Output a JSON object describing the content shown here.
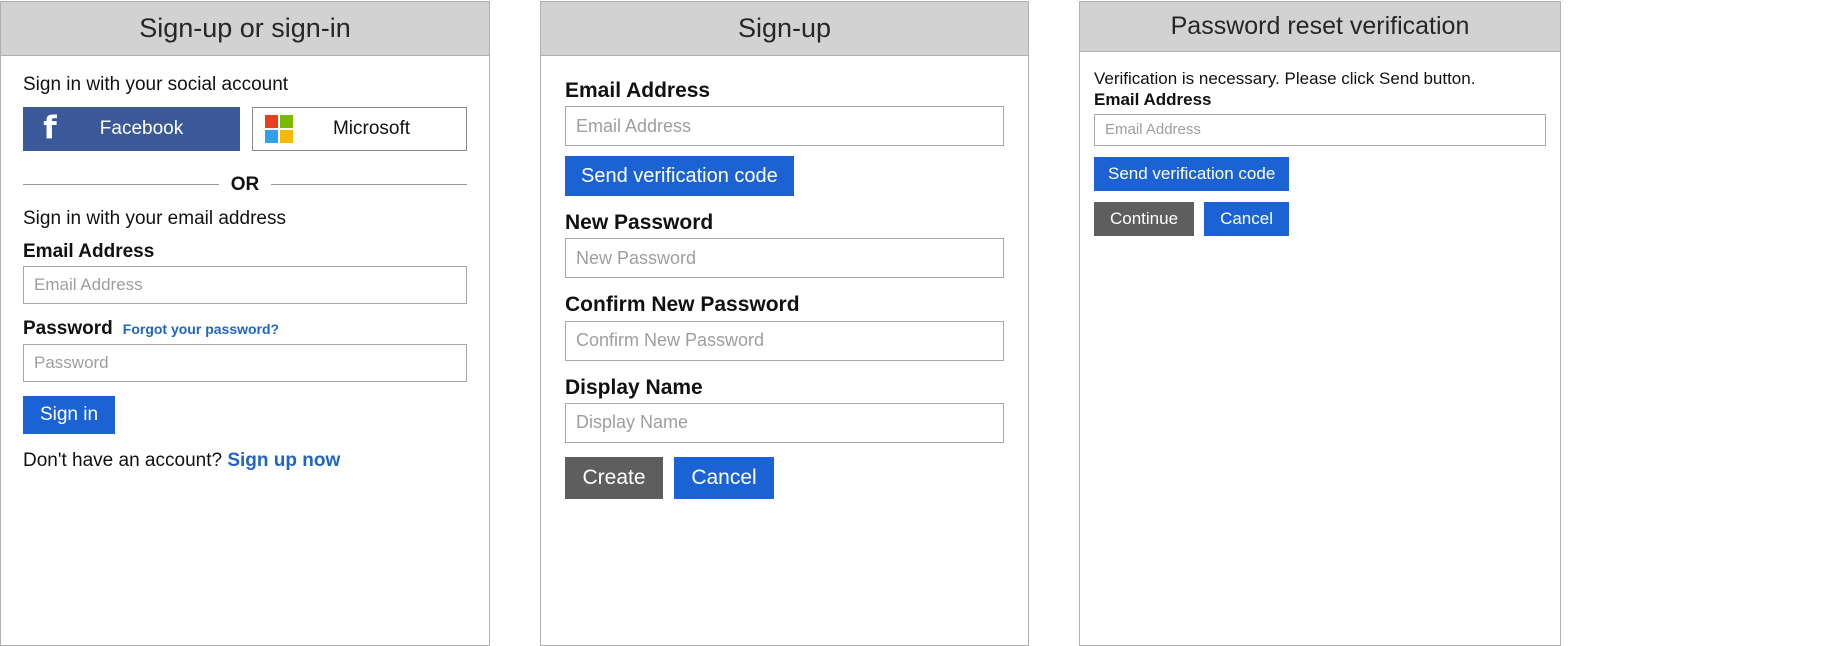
{
  "colors": {
    "header_bg": "#d2d2d2",
    "panel_border": "#b0b0b0",
    "primary_blue": "#1b63d4",
    "secondary_gray": "#5e5e5e",
    "facebook_blue": "#3b5998",
    "link_blue": "#2064c8",
    "ms_red": "#e8401f",
    "ms_green": "#7cba00",
    "ms_blue": "#2fa1e8",
    "ms_yellow": "#f8b900",
    "placeholder_gray": "#9e9e9e"
  },
  "panels": {
    "signin": {
      "title": "Sign-up or sign-in",
      "social_heading": "Sign in with your social account",
      "facebook_button": {
        "label": "Facebook",
        "icon": "facebook-f-icon",
        "glyph": "f"
      },
      "microsoft_button": {
        "label": "Microsoft",
        "icon": "microsoft-squares-icon"
      },
      "divider_text": "OR",
      "email_heading": "Sign in with your email address",
      "email_label": "Email Address",
      "email_placeholder": "Email Address",
      "email_value": "",
      "password_label": "Password",
      "forgot_link": "Forgot your password?",
      "password_placeholder": "Password",
      "password_value": "",
      "signin_button": "Sign in",
      "no_account_text": "Don't have an account?",
      "signup_link": "Sign up now"
    },
    "signup": {
      "title": "Sign-up",
      "email_label": "Email Address",
      "email_placeholder": "Email Address",
      "email_value": "",
      "send_code_button": "Send verification code",
      "new_password_label": "New Password",
      "new_password_placeholder": "New Password",
      "new_password_value": "",
      "confirm_password_label": "Confirm New Password",
      "confirm_password_placeholder": "Confirm New Password",
      "confirm_password_value": "",
      "display_name_label": "Display Name",
      "display_name_placeholder": "Display Name",
      "display_name_value": "",
      "create_button": "Create",
      "cancel_button": "Cancel"
    },
    "reset": {
      "title": "Password reset verification",
      "note": "Verification is necessary. Please click Send button.",
      "email_label": "Email Address",
      "email_placeholder": "Email Address",
      "email_value": "",
      "send_code_button": "Send verification code",
      "continue_button": "Continue",
      "cancel_button": "Cancel"
    }
  }
}
